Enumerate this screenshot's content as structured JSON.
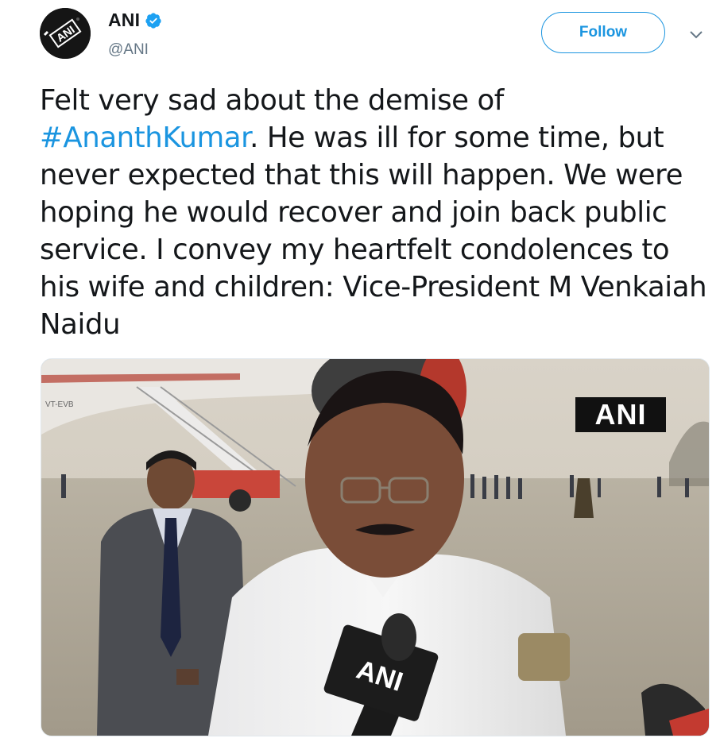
{
  "account": {
    "display_name": "ANI",
    "handle": "@ANI",
    "verified": true,
    "avatar_icon": "ani-logo-avatar-icon"
  },
  "actions": {
    "follow_label": "Follow",
    "more_icon": "chevron-down-icon"
  },
  "tweet": {
    "text_before": "Felt very sad about the demise of ",
    "hashtag": "#AnanthKumar",
    "text_after": ". He was ill for some time, but never expected that this will happen. We were hoping he would recover and join back public service. I convey my heartfelt condolences to his wife and children: Vice-President M Venkaiah Naidu"
  },
  "media": {
    "watermark": "ANI",
    "mic_label": "ANI",
    "aircraft_registration": "VT-EVB"
  },
  "colors": {
    "accent": "#1b95e0",
    "text": "#14171a",
    "secondary_text": "#657786"
  }
}
